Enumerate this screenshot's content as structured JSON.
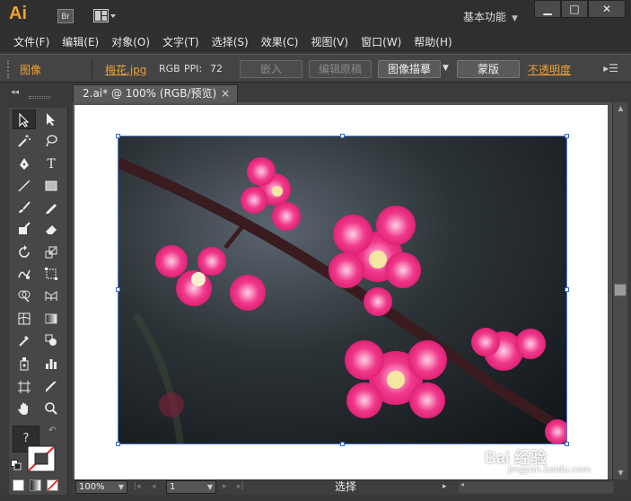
{
  "app": {
    "logo_text": "Ai",
    "bridge_label": "Br",
    "workspace_label": "基本功能",
    "window_buttons": [
      "▁",
      "□",
      "✕"
    ]
  },
  "menu": [
    "文件(F)",
    "编辑(E)",
    "对象(O)",
    "文字(T)",
    "选择(S)",
    "效果(C)",
    "视图(V)",
    "窗口(W)",
    "帮助(H)"
  ],
  "control_bar": {
    "object_type": "图像",
    "file_name": "梅花.jpg",
    "color_mode": "RGB",
    "ppi_label": "PPI:",
    "ppi_value": "72",
    "embed_button": "嵌入",
    "edit_original_button": "编辑原稿",
    "image_trace_button": "图像描摹",
    "mask_button": "蒙版",
    "opacity_label": "不透明度"
  },
  "document": {
    "tab_label": "2.ai* @ 100% (RGB/预览)",
    "tab_close": "×"
  },
  "tools_panel": {
    "collapse_arrows": "◂◂",
    "help_label": "?"
  },
  "status_bar": {
    "zoom_value": "100%",
    "page_value": "1",
    "status_text": "选择"
  },
  "watermark": {
    "brand": "Bai 经验",
    "url": "jingyan.baidu.com"
  },
  "colors": {
    "accent_orange": "#f0a030",
    "selection_blue": "#4f7fd6",
    "flower_pink": "#e8267a"
  }
}
